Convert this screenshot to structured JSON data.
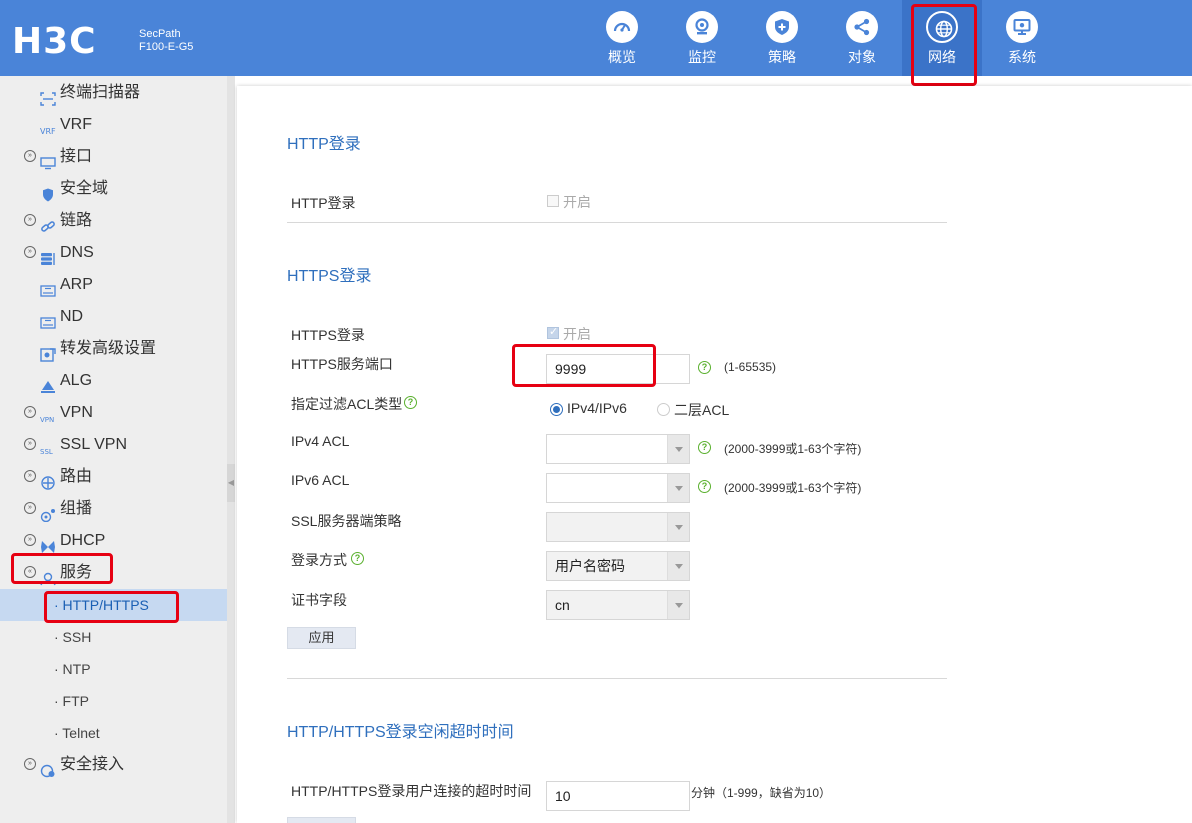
{
  "header": {
    "logo": "H3C",
    "model_line1": "SecPath",
    "model_line2": "F100-E-G5",
    "nav": [
      {
        "label": "概览",
        "icon": "gauge-icon"
      },
      {
        "label": "监控",
        "icon": "webcam-icon"
      },
      {
        "label": "策略",
        "icon": "shield-plus-icon"
      },
      {
        "label": "对象",
        "icon": "share-icon"
      },
      {
        "label": "网络",
        "icon": "globe-icon",
        "active": true
      },
      {
        "label": "系统",
        "icon": "monitor-gear-icon"
      }
    ]
  },
  "sidebar": {
    "items": [
      {
        "label": "终端扫描器",
        "icon": "scanner-icon"
      },
      {
        "label": "VRF",
        "icon": "vrf-icon"
      },
      {
        "label": "接口",
        "icon": "interface-icon"
      },
      {
        "label": "安全域",
        "icon": "shield-icon"
      },
      {
        "label": "链路",
        "icon": "link-icon"
      },
      {
        "label": "DNS",
        "icon": "dns-icon"
      },
      {
        "label": "ARP",
        "icon": "arp-icon"
      },
      {
        "label": "ND",
        "icon": "nd-icon"
      },
      {
        "label": "转发高级设置",
        "icon": "forward-settings-icon"
      },
      {
        "label": "ALG",
        "icon": "alg-icon"
      },
      {
        "label": "VPN",
        "icon": "vpn-icon"
      },
      {
        "label": "SSL VPN",
        "icon": "ssl-vpn-icon"
      },
      {
        "label": "路由",
        "icon": "route-icon"
      },
      {
        "label": "组播",
        "icon": "multicast-icon"
      },
      {
        "label": "DHCP",
        "icon": "dhcp-icon"
      },
      {
        "label": "服务",
        "icon": "service-icon"
      },
      {
        "label": "安全接入",
        "icon": "secure-access-icon"
      }
    ],
    "sub_items": [
      {
        "label": "· HTTP/HTTPS",
        "active": true
      },
      {
        "label": "· SSH"
      },
      {
        "label": "· NTP"
      },
      {
        "label": "· FTP"
      },
      {
        "label": "· Telnet"
      }
    ]
  },
  "http": {
    "section_title": "HTTP登录",
    "login_label": "HTTP登录",
    "enable_text": "开启"
  },
  "https": {
    "section_title": "HTTPS登录",
    "login_label": "HTTPS登录",
    "enable_text": "开启",
    "port_label": "HTTPS服务端口",
    "port_value": "9999",
    "port_hint": "(1-65535)",
    "acl_type_label": "指定过滤ACL类型",
    "acl_options": [
      "IPv4/IPv6",
      "二层ACL"
    ],
    "ipv4_acl_label": "IPv4 ACL",
    "ipv4_acl_hint": "(2000-3999或1-63个字符)",
    "ipv6_acl_label": "IPv6 ACL",
    "ipv6_acl_hint": "(2000-3999或1-63个字符)",
    "ssl_policy_label": "SSL服务器端策略",
    "login_method_label": "登录方式",
    "login_method_value": "用户名密码",
    "cert_field_label": "证书字段",
    "cert_field_value": "cn",
    "apply_button": "应用"
  },
  "timeout": {
    "section_title": "HTTP/HTTPS登录空闲超时时间",
    "label": "HTTP/HTTPS登录用户连接的超时时间",
    "value": "10",
    "hint": "分钟（1-999，缺省为10）"
  },
  "colors": {
    "header_bg": "#4a84d8",
    "accent": "#2f6fbd",
    "highlight": "#e60012",
    "help_green": "#5ab02e"
  }
}
